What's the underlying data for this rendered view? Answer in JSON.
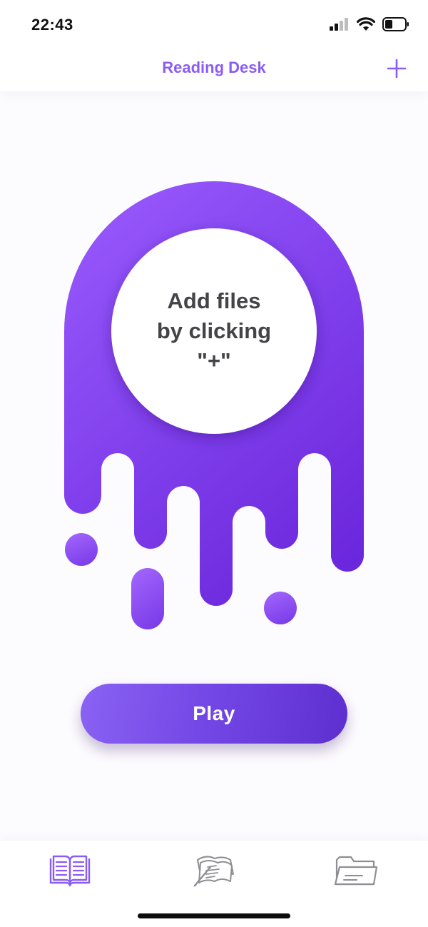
{
  "status_bar": {
    "time": "22:43"
  },
  "nav": {
    "title": "Reading Desk",
    "add_icon": "plus-icon"
  },
  "main": {
    "empty_message": "Add files\nby clicking\n\"+\"",
    "play_label": "Play"
  },
  "tab_bar": {
    "tabs": [
      {
        "icon": "book-icon",
        "active": true
      },
      {
        "icon": "notes-icon",
        "active": false
      },
      {
        "icon": "folder-icon",
        "active": false
      }
    ]
  },
  "colors": {
    "accent": "#8a5cf5",
    "blob_top": "#9657fb",
    "blob_bottom": "#6a27dc",
    "text_dark": "#444448",
    "tab_inactive": "#8e8e93"
  }
}
